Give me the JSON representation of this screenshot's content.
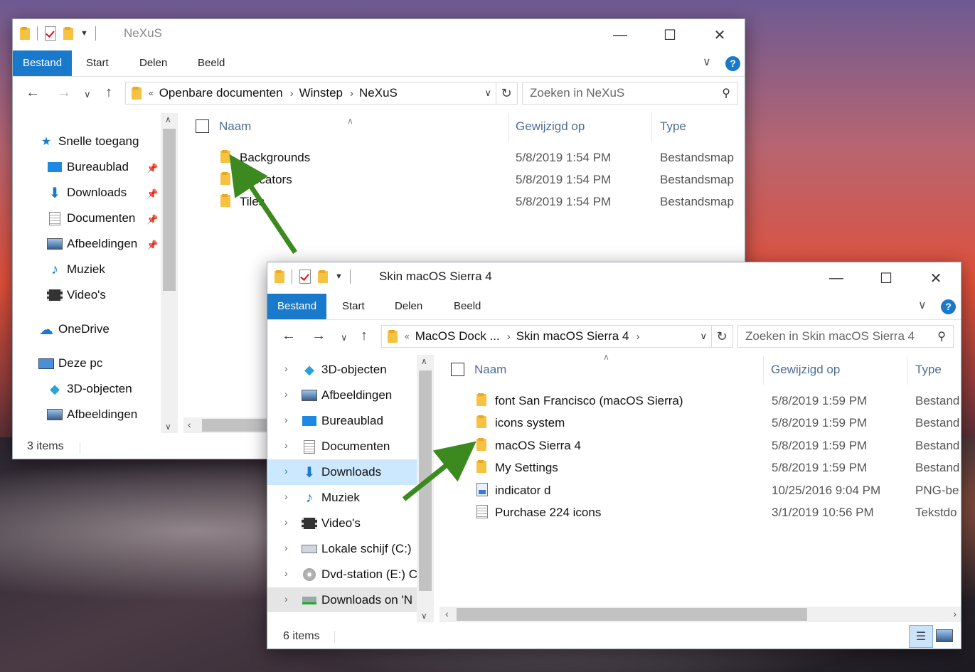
{
  "window1": {
    "title": "NeXuS",
    "tabs": [
      "Bestand",
      "Start",
      "Delen",
      "Beeld"
    ],
    "breadcrumb": [
      "Openbare documenten",
      "Winstep",
      "NeXuS"
    ],
    "search_placeholder": "Zoeken in NeXuS",
    "columns": {
      "name": "Naam",
      "modified": "Gewijzigd op",
      "type": "Type"
    },
    "nav": [
      {
        "label": "Snelle toegang",
        "icon": "star-icon"
      },
      {
        "label": "Bureaublad",
        "icon": "desktop-icon",
        "pinned": true
      },
      {
        "label": "Downloads",
        "icon": "download-icon",
        "pinned": true
      },
      {
        "label": "Documenten",
        "icon": "document-icon",
        "pinned": true
      },
      {
        "label": "Afbeeldingen",
        "icon": "pictures-icon",
        "pinned": true
      },
      {
        "label": "Muziek",
        "icon": "music-icon"
      },
      {
        "label": "Video's",
        "icon": "video-icon"
      },
      {
        "label": "OneDrive",
        "icon": "cloud-icon"
      },
      {
        "label": "Deze pc",
        "icon": "pc-icon"
      },
      {
        "label": "3D-objecten",
        "icon": "cube-icon"
      },
      {
        "label": "Afbeeldingen",
        "icon": "pictures-icon"
      }
    ],
    "files": [
      {
        "name": "Backgrounds",
        "modified": "5/8/2019 1:54 PM",
        "type": "Bestandsmap"
      },
      {
        "name": "Indicators",
        "modified": "5/8/2019 1:54 PM",
        "type": "Bestandsmap"
      },
      {
        "name": "Tiles",
        "modified": "5/8/2019 1:54 PM",
        "type": "Bestandsmap"
      }
    ],
    "status": "3 items"
  },
  "window2": {
    "title": "Skin macOS Sierra 4",
    "tabs": [
      "Bestand",
      "Start",
      "Delen",
      "Beeld"
    ],
    "breadcrumb": [
      "MacOS Dock ...",
      "Skin macOS Sierra 4"
    ],
    "search_placeholder": "Zoeken in Skin macOS Sierra 4",
    "columns": {
      "name": "Naam",
      "modified": "Gewijzigd op",
      "type": "Type"
    },
    "nav": [
      {
        "label": "3D-objecten",
        "icon": "cube-icon"
      },
      {
        "label": "Afbeeldingen",
        "icon": "pictures-icon"
      },
      {
        "label": "Bureaublad",
        "icon": "desktop-icon"
      },
      {
        "label": "Documenten",
        "icon": "document-icon"
      },
      {
        "label": "Downloads",
        "icon": "download-icon",
        "selected": true
      },
      {
        "label": "Muziek",
        "icon": "music-icon"
      },
      {
        "label": "Video's",
        "icon": "video-icon"
      },
      {
        "label": "Lokale schijf (C:)",
        "icon": "drive-icon"
      },
      {
        "label": "Dvd-station (E:) C",
        "icon": "dvd-icon"
      },
      {
        "label": "Downloads on 'N",
        "icon": "network-drive-icon",
        "hover": true
      }
    ],
    "files": [
      {
        "name": "font San Francisco (macOS Sierra)",
        "modified": "5/8/2019 1:59 PM",
        "type": "Bestand",
        "icon": "folder"
      },
      {
        "name": "icons system",
        "modified": "5/8/2019 1:59 PM",
        "type": "Bestand",
        "icon": "folder"
      },
      {
        "name": "macOS Sierra 4",
        "modified": "5/8/2019 1:59 PM",
        "type": "Bestand",
        "icon": "folder"
      },
      {
        "name": "My Settings",
        "modified": "5/8/2019 1:59 PM",
        "type": "Bestand",
        "icon": "folder"
      },
      {
        "name": "indicator d",
        "modified": "10/25/2016 9:04 PM",
        "type": "PNG-be",
        "icon": "image"
      },
      {
        "name": "Purchase 224 icons",
        "modified": "3/1/2019 10:56 PM",
        "type": "Tekstdo",
        "icon": "text"
      }
    ],
    "status": "6 items"
  },
  "colors": {
    "accent": "#1979ca",
    "arrow": "#3c8a1f",
    "header_text": "#4e6e92"
  }
}
